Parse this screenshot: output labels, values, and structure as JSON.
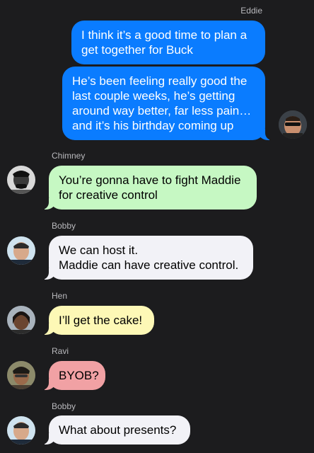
{
  "conversation": {
    "messages": [
      {
        "sender": "Eddie",
        "side": "out",
        "text": "I think it’s a good time to plan a get together for Buck"
      },
      {
        "sender": "Eddie",
        "side": "out",
        "text": "He’s been feeling really good the last couple weeks, he’s getting around way better, far less pain… and it’s his birthday coming up"
      },
      {
        "sender": "Chimney",
        "side": "in",
        "text": "You’re gonna have to fight Maddie for creative control",
        "color": "#c6f8c3"
      },
      {
        "sender": "Bobby",
        "side": "in",
        "text": "We can host it.\nMaddie can have creative control.",
        "color": "#f2f2f7"
      },
      {
        "sender": "Hen",
        "side": "in",
        "text": "I’ll get the cake!",
        "color": "#fdf8b6"
      },
      {
        "sender": "Ravi",
        "side": "in",
        "text": "BYOB?",
        "color": "#f1a1a4"
      },
      {
        "sender": "Bobby",
        "side": "in",
        "text": "What about presents?",
        "color": "#f2f2f7"
      }
    ]
  },
  "icons": {
    "eddie": "avatar-eddie-icon",
    "chimney": "avatar-chimney-icon",
    "bobby": "avatar-bobby-icon",
    "hen": "avatar-hen-icon",
    "ravi": "avatar-ravi-icon"
  },
  "colors": {
    "background": "#1c1c1e",
    "outgoing": "#0a7cff",
    "sender_label": "#b9b9bd"
  }
}
